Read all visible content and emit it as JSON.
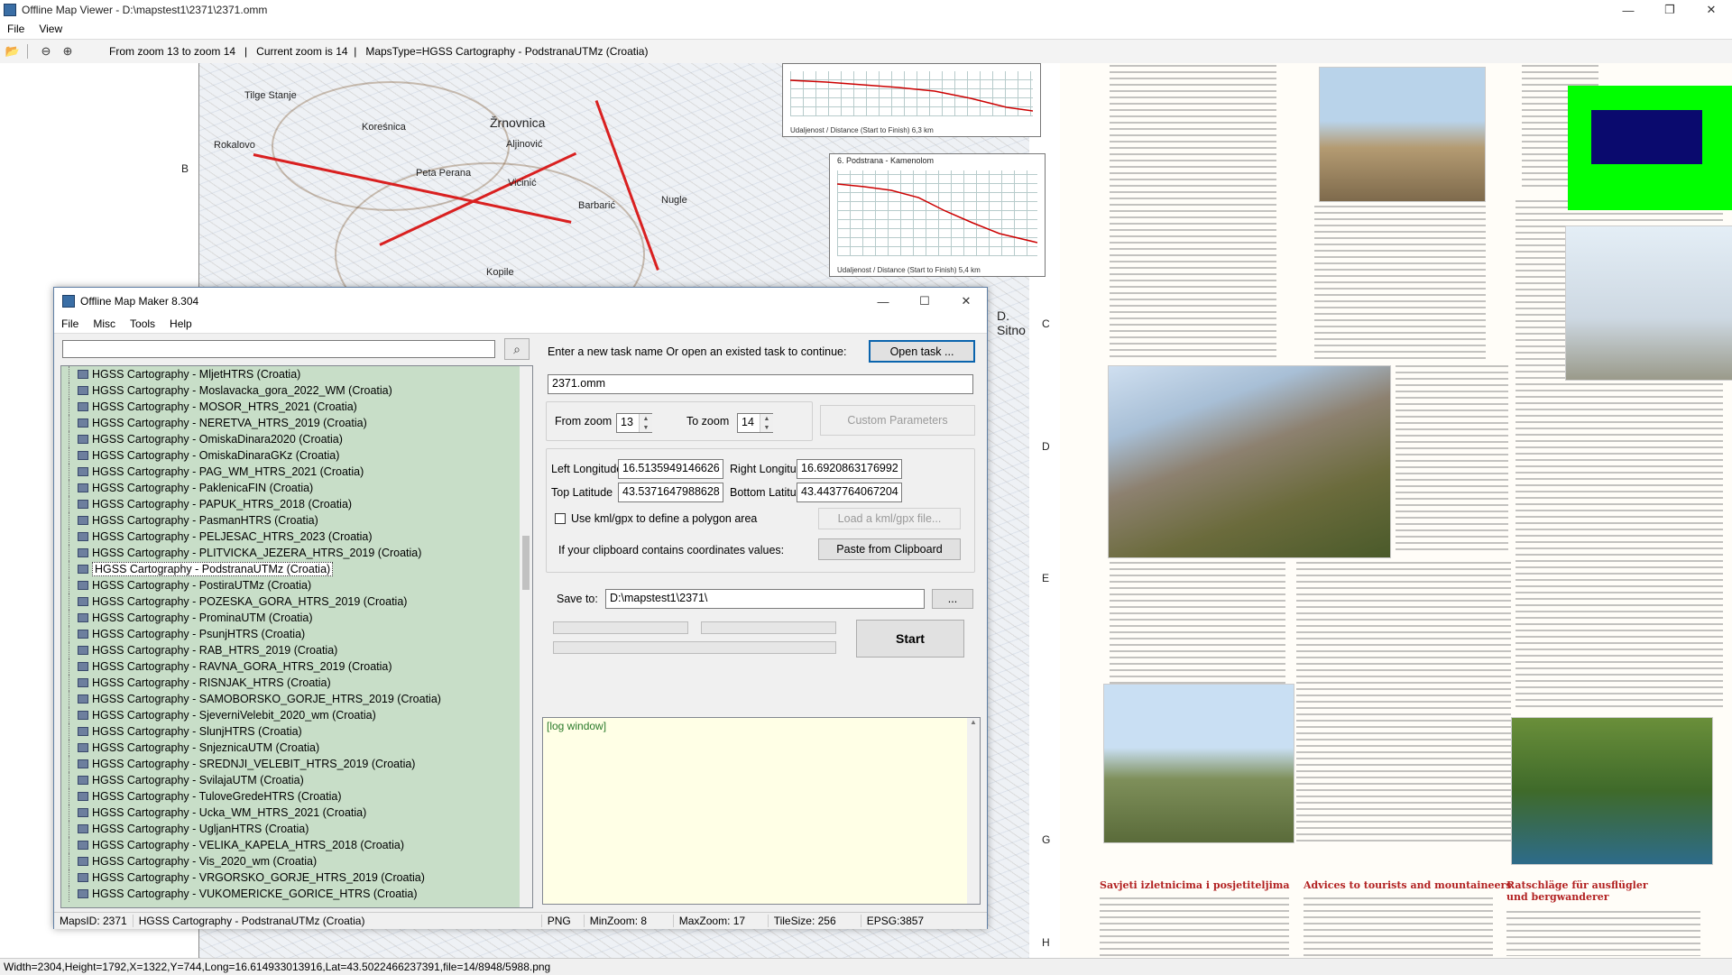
{
  "viewer": {
    "title": "Offline Map Viewer - D:\\mapstest1\\2371\\2371.omm",
    "menu": [
      "File",
      "View"
    ],
    "toolbar_text": "From zoom 13 to zoom 14   |   Current zoom is 14  |   MapsType=HGSS Cartography - PodstranaUTMz (Croatia)",
    "status": "Width=2304,Height=1792,X=1322,Y=744,Long=16.614933013916,Lat=43.5022466237391,file=14/8948/5988.png",
    "window_controls": [
      "—",
      "❐",
      "✕"
    ]
  },
  "map": {
    "labels": {
      "zrnovnica": "Žrnovnica",
      "rokolovo": "Rokalovo",
      "koresnica": "Koreśnica",
      "barbaric": "Barbarić",
      "nugli": "Nugle",
      "vicinic": "Vicinić",
      "peta_perana": "Peta Perana",
      "sitno": "D. Sitno",
      "kopile": "Kopile",
      "aljinovic": "Aljinović",
      "tilge_stanje": "Tilge Stanje",
      "chart2_title": "6. Podstrana - Kamenolom",
      "chart1_cap": "Udaljenost / Distance (Start to Finish) 6,3 km",
      "chart2_cap": "Udaljenost / Distance (Start to Finish) 5,4 km"
    },
    "grid_letters": [
      "B",
      "C",
      "D",
      "E",
      "G",
      "H"
    ]
  },
  "maker": {
    "title": "Offline Map Maker 8.304",
    "menu": [
      "File",
      "Misc",
      "Tools",
      "Help"
    ],
    "window_controls": [
      "—",
      "☐",
      "✕"
    ],
    "search_value": "",
    "search_icon": "magnifier-icon",
    "map_list": [
      "HGSS Cartography - MljetHTRS (Croatia)",
      "HGSS Cartography - Moslavacka_gora_2022_WM (Croatia)",
      "HGSS Cartography - MOSOR_HTRS_2021 (Croatia)",
      "HGSS Cartography - NERETVA_HTRS_2019 (Croatia)",
      "HGSS Cartography - OmiskaDinara2020 (Croatia)",
      "HGSS Cartography - OmiskaDinaraGKz (Croatia)",
      "HGSS Cartography - PAG_WM_HTRS_2021 (Croatia)",
      "HGSS Cartography - PaklenicaFIN (Croatia)",
      "HGSS Cartography - PAPUK_HTRS_2018 (Croatia)",
      "HGSS Cartography - PasmanHTRS (Croatia)",
      "HGSS Cartography - PELJESAC_HTRS_2023 (Croatia)",
      "HGSS Cartography - PLITVICKA_JEZERA_HTRS_2019 (Croatia)",
      "HGSS Cartography - PodstranaUTMz (Croatia)",
      "HGSS Cartography - PostiraUTMz (Croatia)",
      "HGSS Cartography - POZESKA_GORA_HTRS_2019 (Croatia)",
      "HGSS Cartography - ProminaUTM (Croatia)",
      "HGSS Cartography - PsunjHTRS (Croatia)",
      "HGSS Cartography - RAB_HTRS_2019 (Croatia)",
      "HGSS Cartography - RAVNA_GORA_HTRS_2019 (Croatia)",
      "HGSS Cartography - RISNJAK_HTRS (Croatia)",
      "HGSS Cartography - SAMOBORSKO_GORJE_HTRS_2019 (Croatia)",
      "HGSS Cartography - SjeverniVelebit_2020_wm (Croatia)",
      "HGSS Cartography - SlunjHTRS (Croatia)",
      "HGSS Cartography - SnjeznicaUTM (Croatia)",
      "HGSS Cartography - SREDNJI_VELEBIT_HTRS_2019 (Croatia)",
      "HGSS Cartography - SvilajaUTM (Croatia)",
      "HGSS Cartography - TuloveGredeHTRS (Croatia)",
      "HGSS Cartography - Ucka_WM_HTRS_2021 (Croatia)",
      "HGSS Cartography - UgljanHTRS (Croatia)",
      "HGSS Cartography - VELIKA_KAPELA_HTRS_2018 (Croatia)",
      "HGSS Cartography - Vis_2020_wm (Croatia)",
      "HGSS Cartography - VRGORSKO_GORJE_HTRS_2019 (Croatia)",
      "HGSS Cartography - VUKOMERICKE_GORICE_HTRS (Croatia)"
    ],
    "selected_index": 12,
    "task_prompt": "Enter a new task name Or open an existed task to continue:",
    "open_task_label": "Open task ...",
    "task_name": "2371.omm",
    "from_zoom_label": "From zoom",
    "from_zoom": "13",
    "to_zoom_label": "To zoom",
    "to_zoom": "14",
    "custom_params_label": "Custom Parameters",
    "left_lon_label": "Left Longitude",
    "left_lon": "16.5135949146626",
    "right_lon_label": "Right Longitude",
    "right_lon": "16.6920863176992",
    "top_lat_label": "Top Latitude",
    "top_lat": "43.5371647988628",
    "bottom_lat_label": "Bottom Latitude",
    "bottom_lat": "43.4437764067204",
    "kml_label": "Use kml/gpx to define a polygon area",
    "kml_checked": false,
    "load_kml_label": "Load a kml/gpx file...",
    "clipboard_label": "If your clipboard contains coordinates values:",
    "paste_label": "Paste from Clipboard",
    "save_to_label": "Save to:",
    "save_to": "D:\\mapstest1\\2371\\",
    "browse_label": "...",
    "start_label": "Start",
    "log_text": "[log window]",
    "status": {
      "maps_id": "MapsID: 2371",
      "map_name": "HGSS Cartography - PodstranaUTMz (Croatia)",
      "format": "PNG",
      "min_zoom": "MinZoom: 8",
      "max_zoom": "MaxZoom: 17",
      "tile_size": "TileSize: 256",
      "epsg": "EPSG:3857"
    }
  },
  "doc": {
    "headings": {
      "h1": "Savjeti izletnicima i posjetiteljima",
      "h2": "Advices to tourists and mountaineers",
      "h3": "Ratschläge für ausflügler und bergwanderer"
    }
  },
  "colors": {
    "list_bg": "#c8dec8",
    "log_bg": "#ffffe6",
    "green_block": "#00ff00",
    "navy_block": "#0a0a6e"
  }
}
